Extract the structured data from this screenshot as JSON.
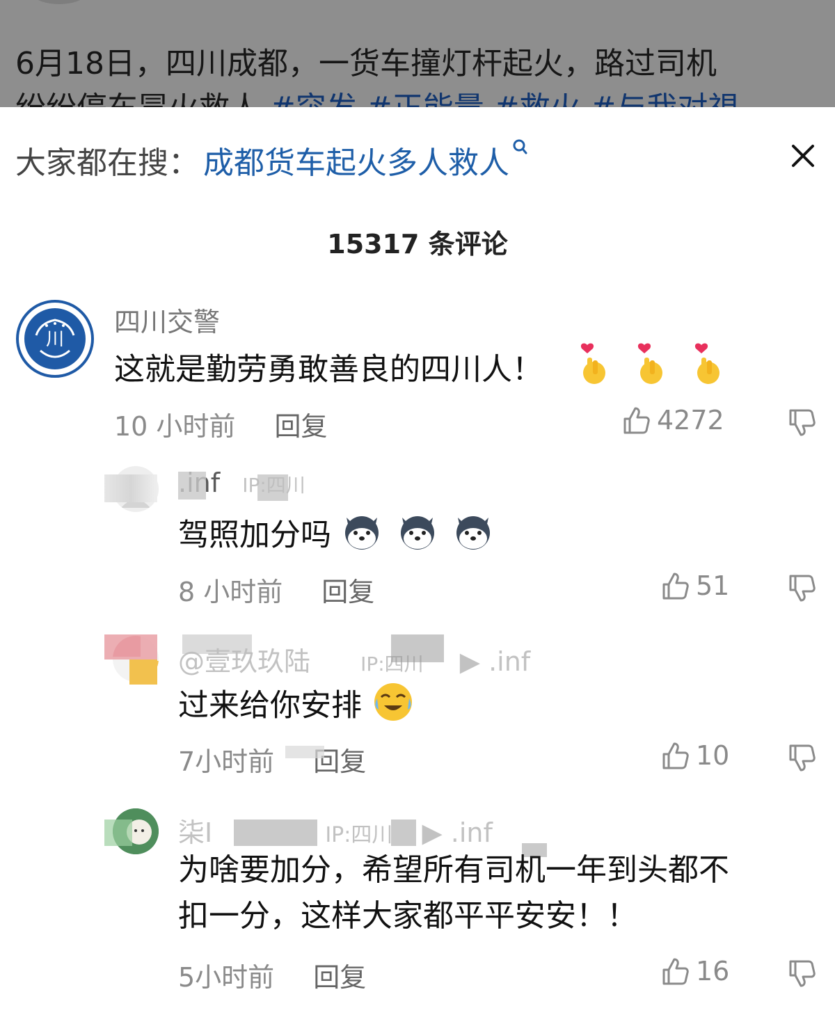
{
  "background_post": {
    "text_line1": "6月18日，四川成都，一货车撞灯杆起火，路过司机",
    "text_line2_plain": "纷纷停车冒火救人",
    "text_line2_tags": "#突发 #正能量 #救火 #与我对視"
  },
  "search": {
    "label": "大家都在搜：",
    "term": "成都货车起火多人救人",
    "icon": "search-icon"
  },
  "close": {
    "icon": "close-icon"
  },
  "comment_count": "15317 条评论",
  "comments": [
    {
      "name": "四川交警",
      "text": "这就是勤劳勇敢善良的四川人！",
      "emojis": [
        "finger-heart-emoji",
        "finger-heart-emoji",
        "finger-heart-emoji"
      ],
      "time": "10 小时前",
      "reply": "回复",
      "likes": "4272"
    },
    {
      "name": ".inf",
      "ip": "IP:四川",
      "text": "驾照加分吗",
      "emojis": [
        "husky-emoji",
        "husky-emoji",
        "husky-emoji"
      ],
      "time": "8 小时前",
      "reply": "回复",
      "likes": "51"
    },
    {
      "name": "@壹玖玖陆",
      "ip": "IP:四川",
      "suffix": "▶ .inf",
      "text": "过来给你安排",
      "emojis": [
        "tears-of-joy-emoji"
      ],
      "time": "7小时前",
      "reply": "回复",
      "likes": "10"
    },
    {
      "name": "柒I",
      "ip": "IP:四川",
      "suffix": "▶ .inf",
      "text_line1": "为啥要加分，希望所有司机一年到头都不",
      "text_line2": "扣一分，这样大家都平平安安！！",
      "time": "5小时前",
      "reply": "回复",
      "likes": "16"
    }
  ]
}
